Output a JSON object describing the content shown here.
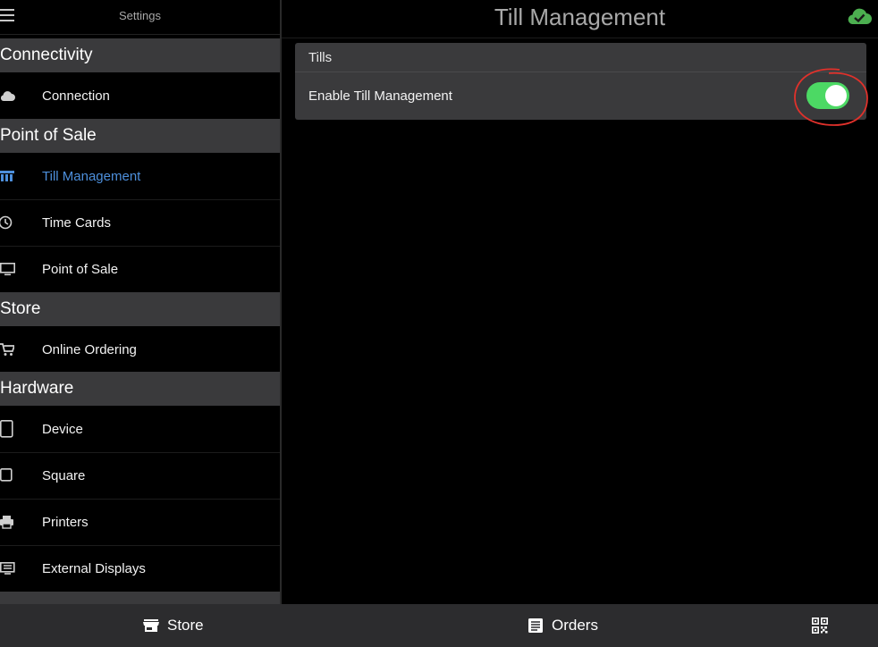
{
  "sidebar": {
    "title": "Settings",
    "sections": [
      {
        "title": "Connectivity"
      },
      {
        "title": "Point of Sale"
      },
      {
        "title": "Store"
      },
      {
        "title": "Hardware"
      }
    ],
    "items": [
      {
        "label": "Connection",
        "icon": "cloud-icon"
      },
      {
        "label": "Till Management",
        "icon": "till-icon",
        "active": true
      },
      {
        "label": "Time Cards",
        "icon": "clock-icon"
      },
      {
        "label": "Point of Sale",
        "icon": "monitor-icon"
      },
      {
        "label": "Online Ordering",
        "icon": "cart-icon"
      },
      {
        "label": "Device",
        "icon": "tablet-icon"
      },
      {
        "label": "Square",
        "icon": "square-icon"
      },
      {
        "label": "Printers",
        "icon": "printer-icon"
      },
      {
        "label": "External Displays",
        "icon": "external-display-icon"
      }
    ]
  },
  "main": {
    "title": "Till Management",
    "status_icon": "cloud-check-icon",
    "card": {
      "title": "Tills",
      "row_label": "Enable Till Management",
      "toggle_on": true
    }
  },
  "bottom_bar": {
    "tabs": [
      {
        "label": "Store",
        "icon": "store-icon"
      },
      {
        "label": "Orders",
        "icon": "orders-icon"
      }
    ],
    "qr_icon": "qr-code-icon"
  },
  "colors": {
    "accent": "#4d8fdb",
    "toggle_on": "#4cd964",
    "annotation": "#e0312b",
    "section_bg": "#3a3a3c",
    "cloud_status": "#4caf50"
  }
}
